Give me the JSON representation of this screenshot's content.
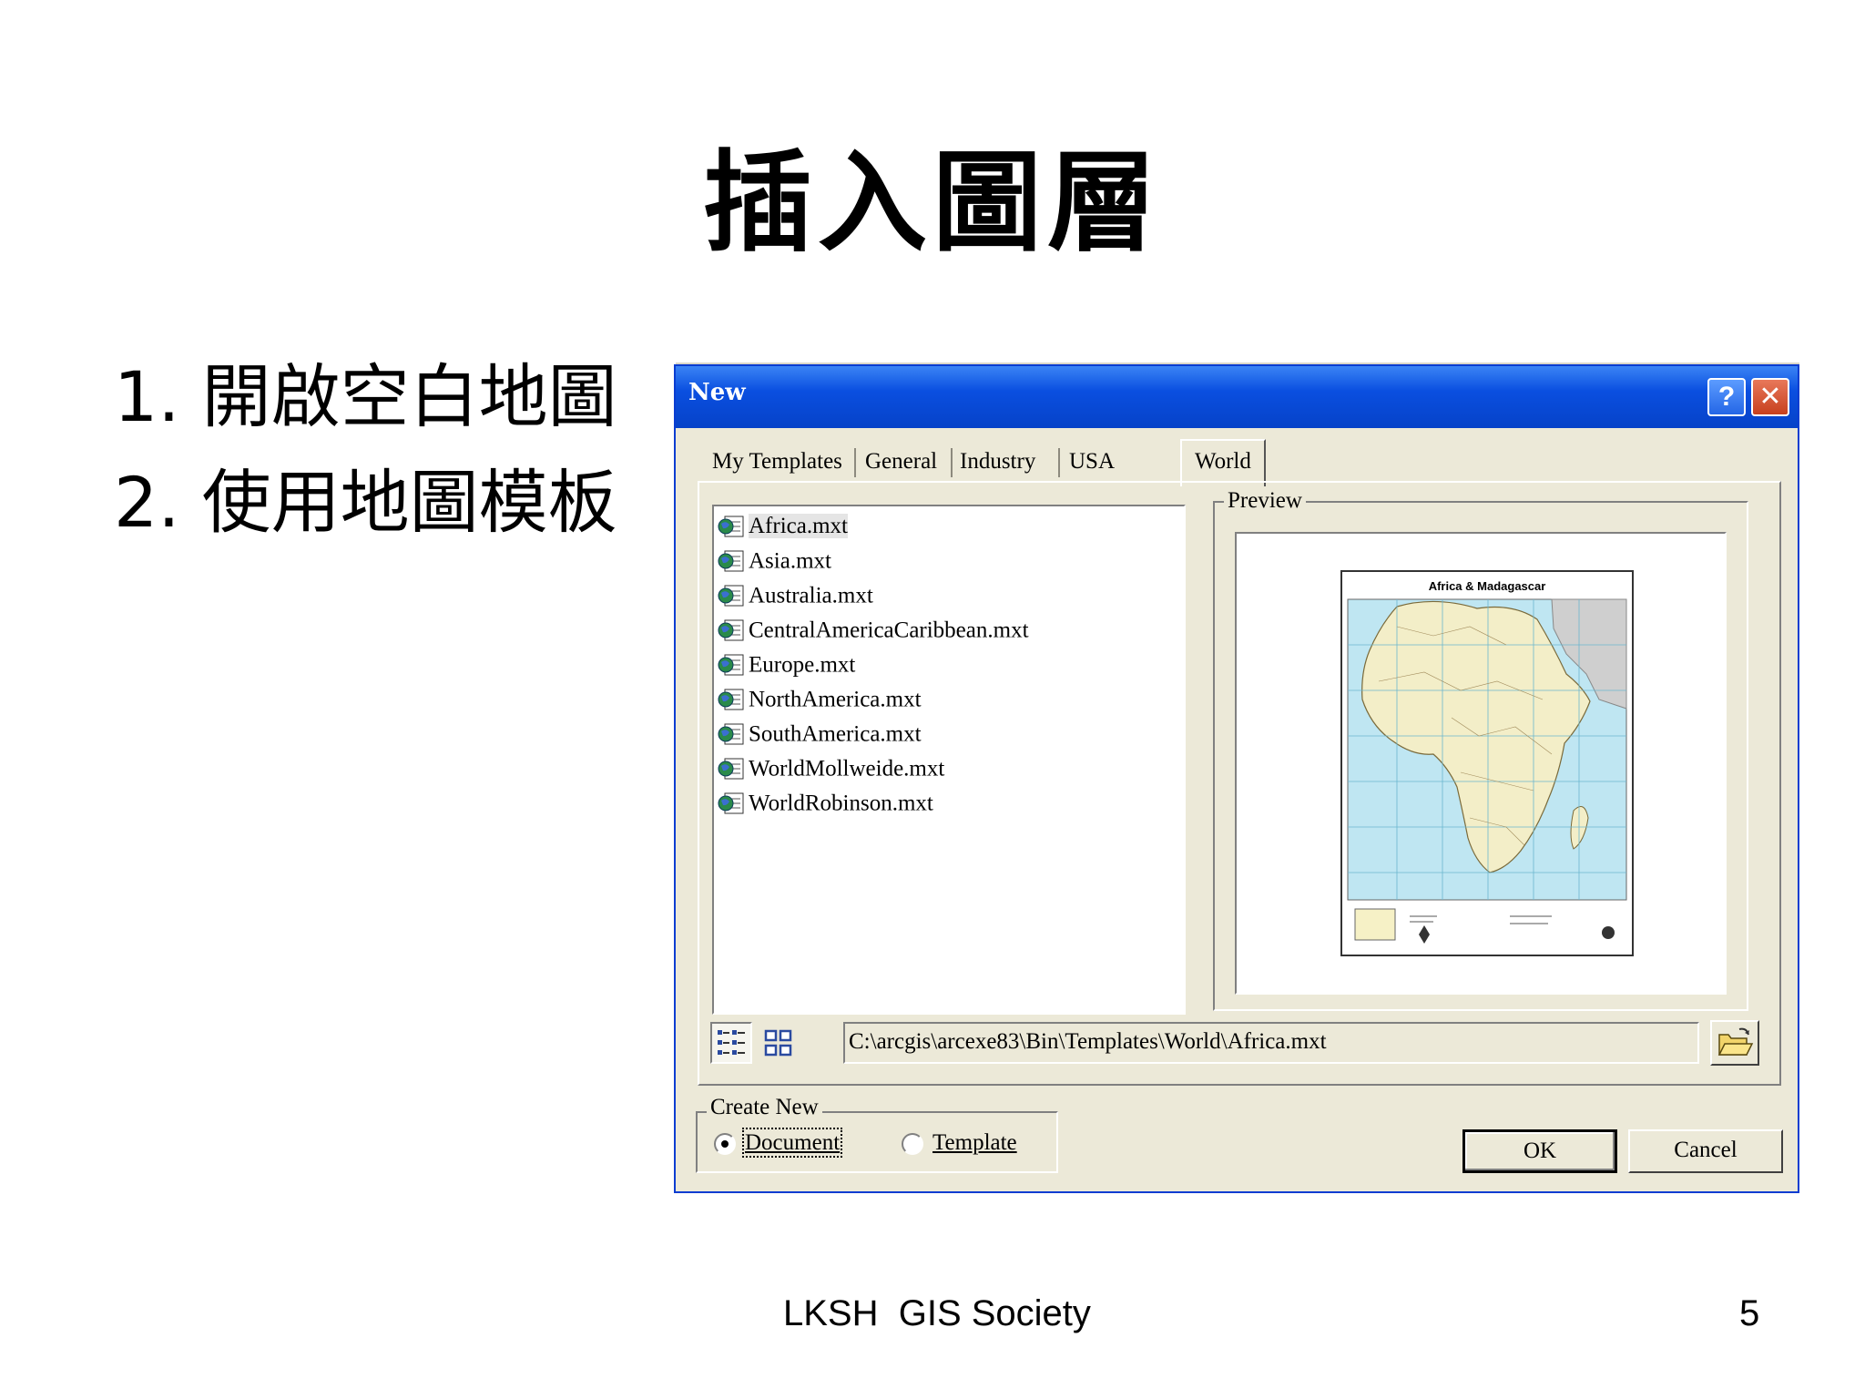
{
  "slide": {
    "title": "插入圖層",
    "bullets": [
      "1. 開啟空白地圖",
      "2. 使用地圖模板"
    ],
    "footer": "LKSH  GIS Society",
    "page_number": "5"
  },
  "dialog": {
    "title": "New",
    "help_label": "?",
    "close_label": "✕",
    "tabs": [
      "My Templates",
      "General",
      "Industry",
      "USA",
      "World"
    ],
    "active_tab": "World",
    "files": [
      "Africa.mxt",
      "Asia.mxt",
      "Australia.mxt",
      "CentralAmericaCaribbean.mxt",
      "Europe.mxt",
      "NorthAmerica.mxt",
      "SouthAmerica.mxt",
      "WorldMollweide.mxt",
      "WorldRobinson.mxt"
    ],
    "selected_file": "Africa.mxt",
    "preview_label": "Preview",
    "preview_map_title": "Africa & Madagascar",
    "path": "C:\\arcgis\\arcexe83\\Bin\\Templates\\World\\Africa.mxt",
    "create_new_label": "Create New",
    "radio_document": "Document",
    "radio_template": "Template",
    "selected_radio": "Document",
    "ok_label": "OK",
    "cancel_label": "Cancel",
    "colors": {
      "titlebar": "#0a4fe0",
      "dialog_bg": "#ece9d8",
      "map_ocean": "#bfe6f2",
      "map_land": "#f3eec8"
    }
  }
}
